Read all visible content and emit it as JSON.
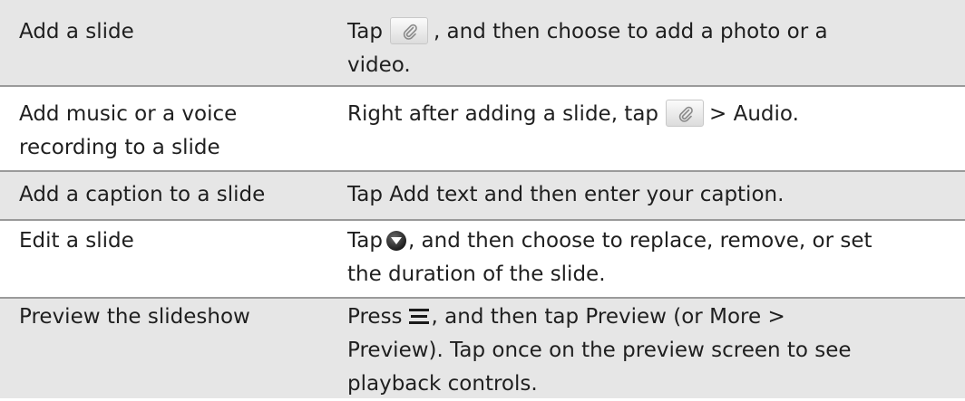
{
  "rows": [
    {
      "action": "Add a slide",
      "desc": {
        "prefix": "Tap",
        "suffix": ", and then choose to add a photo or a",
        "line2": "video."
      }
    },
    {
      "action_line1": "Add music or a voice",
      "action_line2": "recording to a slide",
      "desc": {
        "prefix": "Right after adding a slide, tap",
        "sep": ">",
        "bold": "Audio",
        "end": "."
      }
    },
    {
      "action": "Add a caption to a slide",
      "desc": {
        "prefix": "Tap",
        "bold": "Add text",
        "suffix": "and then enter your caption."
      }
    },
    {
      "action": "Edit a slide",
      "desc": {
        "prefix": "Tap",
        "suffix": ", and then choose to replace, remove, or set",
        "line2": "the duration of the slide."
      }
    },
    {
      "action": "Preview the slideshow",
      "desc": {
        "prefix": "Press",
        "mid1": ", and then tap",
        "bold1": "Preview",
        "mid2": "(or",
        "bold2": "More",
        "sep": ">",
        "bold3": "Preview",
        "mid3": "). Tap once on the preview screen to see",
        "line3": "playback controls."
      }
    }
  ],
  "icons": {
    "attach": "paperclip-icon",
    "options": "down-arrow-circle-icon",
    "menu": "menu-icon"
  }
}
